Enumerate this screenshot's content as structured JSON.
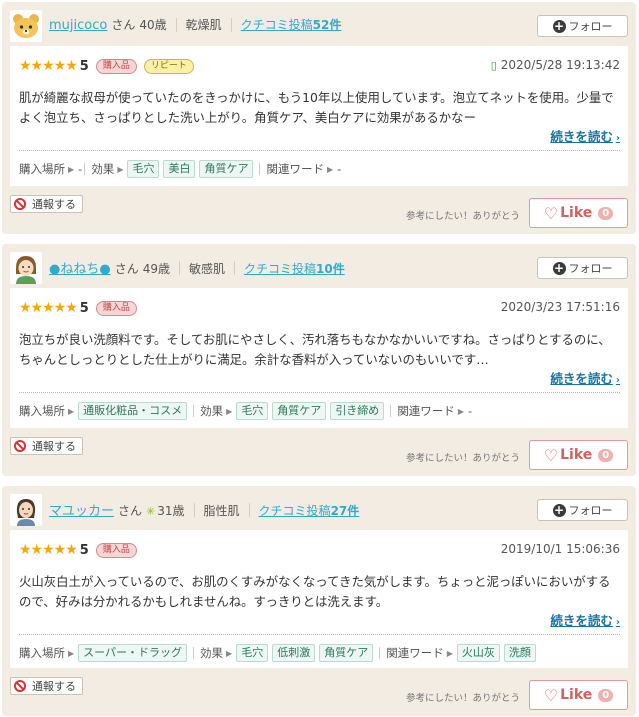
{
  "reviews": [
    {
      "user": {
        "name": "mujicoco",
        "san": "さん",
        "age": "40歳",
        "skin": "乾燥肌",
        "kuchi_prefix": "クチコミ投稿",
        "kuchi_count": "52件"
      },
      "follow": "フォロー",
      "rating": {
        "stars": "★★★★★",
        "score": "5"
      },
      "badges": [
        "購入品",
        "リピート"
      ],
      "date": "2020/5/28 19:13:42",
      "text": "肌が綺麗な叔母が使っていたのをきっかけに、もう10年以上使用しています。泡立てネットを使用。少量でよく泡立ち、さっぱりとした洗い上がり。角質ケア、美白ケアに効果があるかなー",
      "more": "続きを読む",
      "place_label": "購入場所",
      "place_values": [
        "-"
      ],
      "effect_label": "効果",
      "effects": [
        "毛穴",
        "美白",
        "角質ケア"
      ],
      "words_label": "関連ワード",
      "words": [
        "-"
      ],
      "report": "通報する",
      "helpful": "参考にしたい！ありがとう",
      "like": "Like",
      "like_count": "0"
    },
    {
      "user": {
        "name": "●ねねち●",
        "san": "さん",
        "age": "49歳",
        "skin": "敏感肌",
        "kuchi_prefix": "クチコミ投稿",
        "kuchi_count": "10件"
      },
      "follow": "フォロー",
      "rating": {
        "stars": "★★★★★",
        "score": "5"
      },
      "badges": [
        "購入品"
      ],
      "date": "2020/3/23 17:51:16",
      "text": "泡立ちが良い洗顔料です。そしてお肌にやさしく、汚れ落ちもなかなかいいですね。さっぱりとするのに、ちゃんとしっとりとした仕上がりに満足。余計な香料が入っていないのもいいです…",
      "more": "続きを読む",
      "place_label": "購入場所",
      "place_values": [
        "通販化粧品・コスメ"
      ],
      "effect_label": "効果",
      "effects": [
        "毛穴",
        "角質ケア",
        "引き締め"
      ],
      "words_label": "関連ワード",
      "words": [
        "-"
      ],
      "report": "通報する",
      "helpful": "参考にしたい！ありがとう",
      "like": "Like",
      "like_count": "0"
    },
    {
      "user": {
        "name": "マユッカー",
        "san": "さん",
        "age": "31歳",
        "skin": "脂性肌",
        "kuchi_prefix": "クチコミ投稿",
        "kuchi_count": "27件"
      },
      "follow": "フォロー",
      "rating": {
        "stars": "★★★★★",
        "score": "5"
      },
      "badges": [
        "購入品"
      ],
      "date": "2019/10/1 15:06:36",
      "text": "火山灰白土が入っているので、お肌のくすみがなくなってきた気がします。ちょっと泥っぽいにおいがするので、好みは分かれるかもしれませんね。すっきりとは洗えます。",
      "more": "続きを読む",
      "place_label": "購入場所",
      "place_values": [
        "スーパー・ドラッグ"
      ],
      "effect_label": "効果",
      "effects": [
        "毛穴",
        "低刺激",
        "角質ケア"
      ],
      "words_label": "関連ワード",
      "words": [
        "火山灰",
        "洗顔"
      ],
      "report": "通報する",
      "helpful": "参考にしたい！ありがとう",
      "like": "Like",
      "like_count": "0"
    }
  ],
  "colors": {
    "accent": "#33aacc",
    "star": "#f6a800",
    "like": "#d6605d",
    "card_bg": "#f2ece2"
  }
}
